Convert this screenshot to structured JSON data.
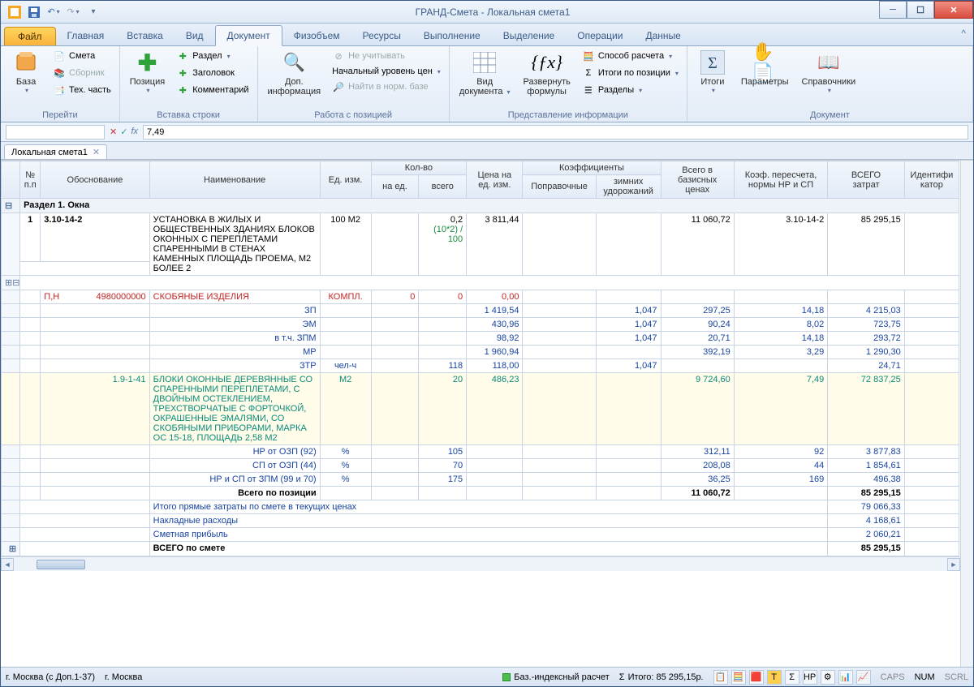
{
  "window": {
    "title": "ГРАНД-Смета - Локальная смета1"
  },
  "tabs": {
    "file": "Файл",
    "items": [
      "Главная",
      "Вставка",
      "Вид",
      "Документ",
      "Физобъем",
      "Ресурсы",
      "Выполнение",
      "Выделение",
      "Операции",
      "Данные"
    ],
    "active_index": 3
  },
  "ribbon": {
    "group1": {
      "label": "Перейти",
      "base": "База",
      "smeta": "Смета",
      "sbornik": "Сборник",
      "tech": "Тех. часть"
    },
    "group2": {
      "label": "Вставка строки",
      "position": "Позиция",
      "razdel": "Раздел",
      "header": "Заголовок",
      "comment": "Комментарий"
    },
    "group3": {
      "label": "Работа с позицией",
      "dopinfo1": "Доп.",
      "dopinfo2": "информация",
      "neuchit": "Не учитывать",
      "level": "Начальный уровень цен",
      "find": "Найти в норм. базе"
    },
    "group4": {
      "label": "Представление информации",
      "view1": "Вид",
      "view2": "документа",
      "expand1": "Развернуть",
      "expand2": "формулы",
      "calc": "Способ расчета",
      "itogi": "Итоги по позиции",
      "hp_sp": "Разделы"
    },
    "group5": {
      "label": "Документ",
      "results": "Итоги",
      "params": "Параметры",
      "sprav": "Справочники"
    }
  },
  "formula": {
    "value": "7,49",
    "fx": "fx"
  },
  "doc_tab": {
    "name": "Локальная смета1"
  },
  "columns": {
    "num": "№\nп.п",
    "basis": "Обоснование",
    "name": "Наименование",
    "unit": "Ед. изм.",
    "qty": "Кол-во",
    "qty_per": "на ед.",
    "qty_total": "всего",
    "price_unit": "Цена на\nед. изм.",
    "coef": "Коэффициенты",
    "coef_corr": "Поправочные",
    "coef_winter": "зимних\nудорожаний",
    "base_total": "Всего в\nбазисных\nценах",
    "recalc": "Коэф. пересчета,\nнормы НР и СП",
    "total": "ВСЕГО\nзатрат",
    "ident": "Идентифи\nкатор"
  },
  "section1": "Раздел 1. Окна",
  "row1": {
    "num": "1",
    "basis": "3.10-14-2",
    "name": "УСТАНОВКА В ЖИЛЫХ И ОБЩЕСТВЕННЫХ ЗДАНИЯХ БЛОКОВ ОКОННЫХ С ПЕРЕПЛЕТАМИ СПАРЕННЫМИ В СТЕНАХ КАМЕННЫХ ПЛОЩАДЬ ПРОЕМА, М2 БОЛЕЕ 2",
    "unit": "100 М2",
    "qty": "0,2",
    "qty_sub": "(10*2) / 100",
    "price": "3 811,44",
    "base": "11 060,72",
    "recalc": "3.10-14-2",
    "total": "85 295,15"
  },
  "row_sk": {
    "pn": "П,Н",
    "code": "4980000000",
    "name": "СКОБЯНЫЕ ИЗДЕЛИЯ",
    "unit": "КОМПЛ.",
    "q1": "0",
    "q2": "0",
    "price": "0,00"
  },
  "detail_rows": [
    {
      "name": "ЗП",
      "price": "1 419,54",
      "coef": "1,047",
      "base": "297,25",
      "recalc": "14,18",
      "total": "4 215,03"
    },
    {
      "name": "ЭМ",
      "price": "430,96",
      "coef": "1,047",
      "base": "90,24",
      "recalc": "8,02",
      "total": "723,75"
    },
    {
      "name": "в т.ч. ЗПМ",
      "price": "98,92",
      "coef": "1,047",
      "base": "20,71",
      "recalc": "14,18",
      "total": "293,72"
    },
    {
      "name": "МР",
      "price": "1 960,94",
      "coef": "",
      "base": "392,19",
      "recalc": "3,29",
      "total": "1 290,30"
    },
    {
      "name": "ЗТР",
      "unit": "чел-ч",
      "qty": "118",
      "price": "118,00",
      "coef": "1,047",
      "base": "",
      "recalc": "",
      "total": "24,71"
    }
  ],
  "row_block": {
    "code": "1.9-1-41",
    "name": "БЛОКИ ОКОННЫЕ ДЕРЕВЯННЫЕ СО СПАРЕННЫМИ ПЕРЕПЛЕТАМИ, С ДВОЙНЫМ ОСТЕКЛЕНИЕМ, ТРЕХСТВОРЧАТЫЕ С ФОРТОЧКОЙ, ОКРАШЕННЫЕ ЭМАЛЯМИ, СО СКОБЯНЫМИ ПРИБОРАМИ, МАРКА ОС 15-18, ПЛОЩАДЬ 2,58 М2",
    "unit": "М2",
    "qty": "20",
    "price": "486,23",
    "base": "9 724,60",
    "recalc": "7,49",
    "total": "72 837,25"
  },
  "hp_rows": [
    {
      "name": "НР от ОЗП (92)",
      "unit": "%",
      "qty": "105",
      "base": "312,11",
      "recalc": "92",
      "total": "3 877,83"
    },
    {
      "name": "СП от ОЗП (44)",
      "unit": "%",
      "qty": "70",
      "base": "208,08",
      "recalc": "44",
      "total": "1 854,61"
    },
    {
      "name": "НР и СП от ЗПМ (99 и 70)",
      "unit": "%",
      "qty": "175",
      "base": "36,25",
      "recalc": "169",
      "total": "496,38"
    }
  ],
  "totals": {
    "pos_label": "Всего по позиции",
    "pos_base": "11 060,72",
    "pos_total": "85 295,15",
    "direct_label": "Итого прямые затраты по смете в текущих ценах",
    "direct_total": "79 066,33",
    "nr_label": "Накладные расходы",
    "nr_total": "4 168,61",
    "sp_label": "Сметная прибыль",
    "sp_total": "2 060,21",
    "all_label": "ВСЕГО по смете",
    "all_total": "85 295,15"
  },
  "status": {
    "left1": "г. Москва (с Доп.1-37)",
    "left2": "г. Москва",
    "calc_mode": "Баз.-индексный расчет",
    "sum_label": "Итого: 85 295,15р.",
    "caps": "CAPS",
    "num": "NUM",
    "scrl": "SCRL"
  }
}
